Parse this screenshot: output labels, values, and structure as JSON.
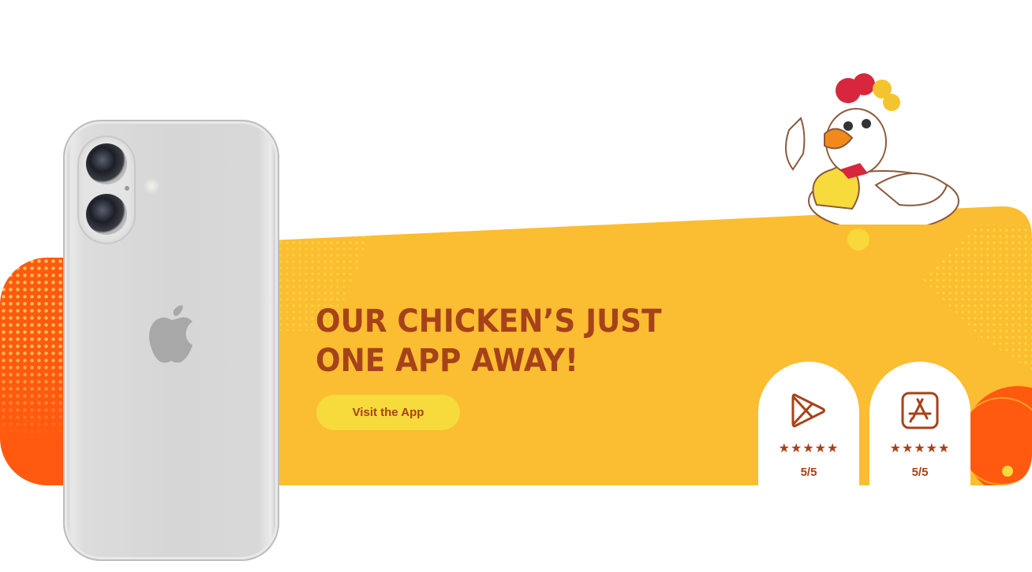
{
  "headline": {
    "line1": "our chicken’s just",
    "line2": "one app away!"
  },
  "cta": {
    "label": "Visit the App"
  },
  "stores": [
    {
      "name": "Google Play",
      "icon": "google-play-icon",
      "stars": "★★★★★",
      "rating": "5/5"
    },
    {
      "name": "App Store",
      "icon": "app-store-icon",
      "stars": "★★★★★",
      "rating": "5/5"
    }
  ],
  "colors": {
    "banner": "#FBBD31",
    "accent_orange": "#FF5A0F",
    "text_brown": "#A6421A",
    "button": "#F7DA3C",
    "card": "#FFFFFF"
  }
}
